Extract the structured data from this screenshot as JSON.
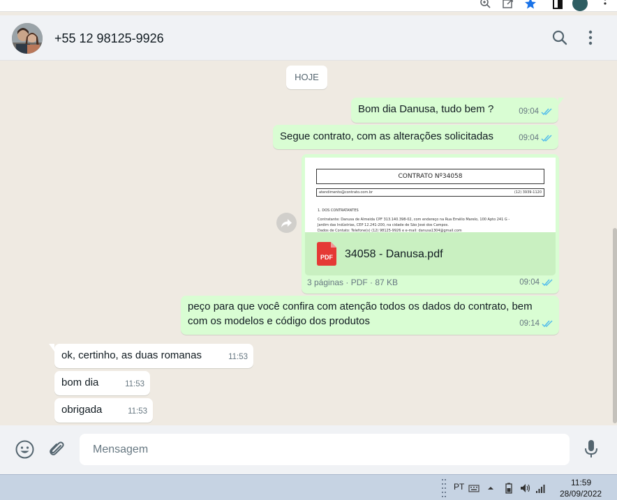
{
  "header": {
    "contact_name": "+55 12 98125-9926"
  },
  "chat": {
    "date_chip": "HOJE",
    "messages": [
      {
        "text": "Bom dia Danusa, tudo bem ?",
        "time": "09:04"
      },
      {
        "text": "Segue contrato, com as alterações solicitadas",
        "time": "09:04"
      },
      {
        "document": {
          "preview_title": "CONTRATO Nº34058",
          "preview_email": "atendimento@contrato.com.br",
          "preview_phone": "(12) 3939-1120",
          "preview_section": "1. DOS CONTRATANTES",
          "preview_line1": "Contratante: Danusa de Almeida  CPF 313.140.398-02, com endereço na Rua Emélio Marelo, 100 Apto 241 G -",
          "preview_line2": "Jardim das Indústrias, CEP 12.241-200, na cidade de São José dos Campos.",
          "preview_line3": "Dados de Contato: Telefone(s) (12) 98125-9926 e e-mail: danusa1304@gmail.com",
          "file_icon_label": "PDF",
          "file_name": "34058 - Danusa.pdf",
          "info": "3 páginas · PDF · 87 KB"
        },
        "time": "09:04"
      },
      {
        "text_line1": "peço para que você confira com atenção todos os dados do contrato, bem",
        "text_line2": "com os modelos e código dos produtos",
        "time": "09:14"
      },
      {
        "text": "ok, certinho, as duas romanas",
        "time": "11:53"
      },
      {
        "text": "bom dia",
        "time": "11:53"
      },
      {
        "text": "obrigada",
        "time": "11:53"
      }
    ]
  },
  "composer": {
    "placeholder": "Mensagem"
  },
  "taskbar": {
    "language": "PT",
    "time": "11:59",
    "date": "28/09/2022"
  },
  "colors": {
    "outgoing_bubble": "#d9fdd3",
    "incoming_bubble": "#ffffff",
    "read_ticks": "#53bdeb",
    "chat_background": "#efeae2",
    "pdf_red": "#e53935"
  },
  "icons": [
    "zoom-icon",
    "share-icon",
    "star-icon",
    "extension-icon",
    "profile-icon",
    "browser-menu-icon",
    "search-icon",
    "menu-dots-icon",
    "forward-icon",
    "pdf-icon",
    "emoji-icon",
    "attach-icon",
    "mic-icon",
    "double-check-icon",
    "battery-icon",
    "volume-icon",
    "signal-icon",
    "keyboard-icon",
    "tray-up-icon"
  ]
}
